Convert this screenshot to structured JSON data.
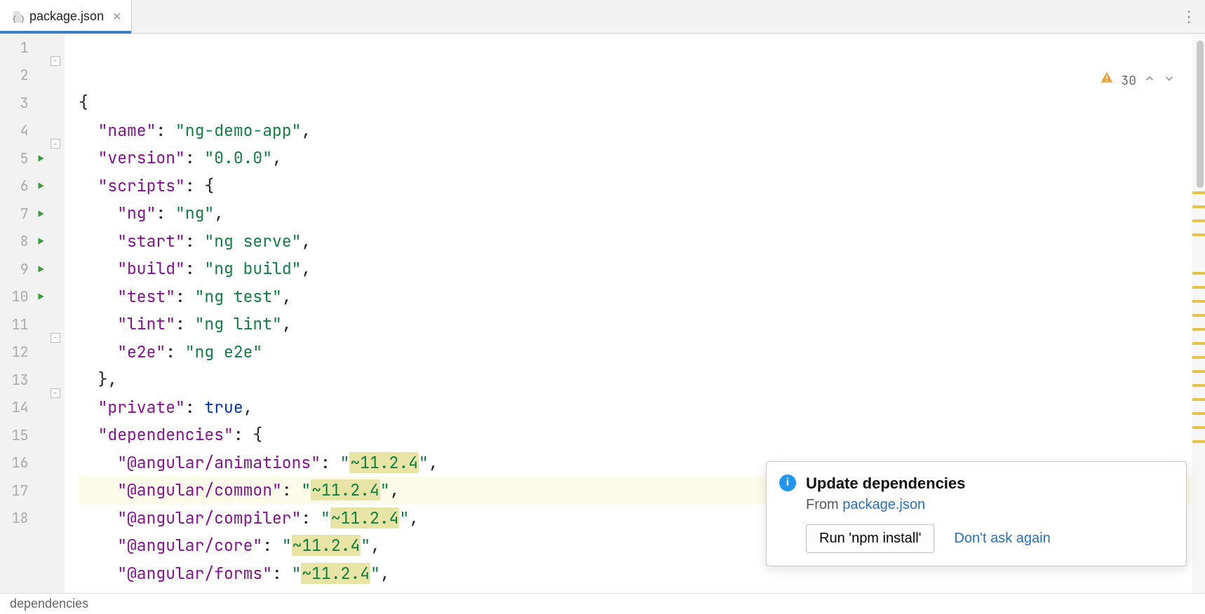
{
  "tab": {
    "filename": "package.json"
  },
  "inspections": {
    "warning_count": "30"
  },
  "breadcrumb": "dependencies",
  "popup": {
    "title": "Update dependencies",
    "from_prefix": "From ",
    "from_file": "package.json",
    "action_button": "Run 'npm install'",
    "action_link": "Don't ask again"
  },
  "code": {
    "lines": [
      {
        "n": "1",
        "run": false,
        "fold": true,
        "tokens": [
          [
            "punc",
            "{"
          ]
        ]
      },
      {
        "n": "2",
        "run": false,
        "fold": false,
        "tokens": [
          [
            "indent",
            "  "
          ],
          [
            "key",
            "\"name\""
          ],
          [
            "punc",
            ": "
          ],
          [
            "str",
            "\"ng-demo-app\""
          ],
          [
            "punc",
            ","
          ]
        ]
      },
      {
        "n": "3",
        "run": false,
        "fold": false,
        "tokens": [
          [
            "indent",
            "  "
          ],
          [
            "key",
            "\"version\""
          ],
          [
            "punc",
            ": "
          ],
          [
            "str",
            "\"0.0.0\""
          ],
          [
            "punc",
            ","
          ]
        ]
      },
      {
        "n": "4",
        "run": false,
        "fold": true,
        "tokens": [
          [
            "indent",
            "  "
          ],
          [
            "key",
            "\"scripts\""
          ],
          [
            "punc",
            ": {"
          ]
        ]
      },
      {
        "n": "5",
        "run": true,
        "fold": false,
        "tokens": [
          [
            "indent",
            "    "
          ],
          [
            "key",
            "\"ng\""
          ],
          [
            "punc",
            ": "
          ],
          [
            "str",
            "\"ng\""
          ],
          [
            "punc",
            ","
          ]
        ]
      },
      {
        "n": "6",
        "run": true,
        "fold": false,
        "tokens": [
          [
            "indent",
            "    "
          ],
          [
            "key",
            "\"start\""
          ],
          [
            "punc",
            ": "
          ],
          [
            "str",
            "\"ng serve\""
          ],
          [
            "punc",
            ","
          ]
        ]
      },
      {
        "n": "7",
        "run": true,
        "fold": false,
        "tokens": [
          [
            "indent",
            "    "
          ],
          [
            "key",
            "\"build\""
          ],
          [
            "punc",
            ": "
          ],
          [
            "str",
            "\"ng build\""
          ],
          [
            "punc",
            ","
          ]
        ]
      },
      {
        "n": "8",
        "run": true,
        "fold": false,
        "tokens": [
          [
            "indent",
            "    "
          ],
          [
            "key",
            "\"test\""
          ],
          [
            "punc",
            ": "
          ],
          [
            "str",
            "\"ng test\""
          ],
          [
            "punc",
            ","
          ]
        ]
      },
      {
        "n": "9",
        "run": true,
        "fold": false,
        "tokens": [
          [
            "indent",
            "    "
          ],
          [
            "key",
            "\"lint\""
          ],
          [
            "punc",
            ": "
          ],
          [
            "str",
            "\"ng lint\""
          ],
          [
            "punc",
            ","
          ]
        ]
      },
      {
        "n": "10",
        "run": true,
        "fold": false,
        "tokens": [
          [
            "indent",
            "    "
          ],
          [
            "key",
            "\"e2e\""
          ],
          [
            "punc",
            ": "
          ],
          [
            "str",
            "\"ng e2e\""
          ]
        ]
      },
      {
        "n": "11",
        "run": false,
        "fold": "close",
        "tokens": [
          [
            "indent",
            "  "
          ],
          [
            "punc",
            "},"
          ]
        ]
      },
      {
        "n": "12",
        "run": false,
        "fold": false,
        "tokens": [
          [
            "indent",
            "  "
          ],
          [
            "key",
            "\"private\""
          ],
          [
            "punc",
            ": "
          ],
          [
            "bool",
            "true"
          ],
          [
            "punc",
            ","
          ]
        ]
      },
      {
        "n": "13",
        "run": false,
        "fold": true,
        "tokens": [
          [
            "indent",
            "  "
          ],
          [
            "key",
            "\"dependencies\""
          ],
          [
            "punc",
            ": {"
          ]
        ]
      },
      {
        "n": "14",
        "run": false,
        "fold": false,
        "tokens": [
          [
            "indent",
            "    "
          ],
          [
            "key",
            "\"@angular/animations\""
          ],
          [
            "punc",
            ": "
          ],
          [
            "hlstr",
            "\"~11.2.4\""
          ],
          [
            "punc",
            ","
          ]
        ]
      },
      {
        "n": "15",
        "run": false,
        "fold": false,
        "current": true,
        "tokens": [
          [
            "indent",
            "    "
          ],
          [
            "key",
            "\"@angular/common\""
          ],
          [
            "punc",
            ": "
          ],
          [
            "hlstr",
            "\"~11.2.4\""
          ],
          [
            "punc",
            ","
          ]
        ]
      },
      {
        "n": "16",
        "run": false,
        "fold": false,
        "tokens": [
          [
            "indent",
            "    "
          ],
          [
            "key",
            "\"@angular/compiler\""
          ],
          [
            "punc",
            ": "
          ],
          [
            "hlstr",
            "\"~11.2.4\""
          ],
          [
            "punc",
            ","
          ]
        ]
      },
      {
        "n": "17",
        "run": false,
        "fold": false,
        "tokens": [
          [
            "indent",
            "    "
          ],
          [
            "key",
            "\"@angular/core\""
          ],
          [
            "punc",
            ": "
          ],
          [
            "hlstr",
            "\"~11.2.4\""
          ],
          [
            "punc",
            ","
          ]
        ]
      },
      {
        "n": "18",
        "run": false,
        "fold": false,
        "tokens": [
          [
            "indent",
            "    "
          ],
          [
            "key",
            "\"@angular/forms\""
          ],
          [
            "punc",
            ": "
          ],
          [
            "hlstr",
            "\"~11.2.4\""
          ],
          [
            "punc",
            ","
          ]
        ]
      }
    ]
  },
  "scroll_marks": [
    225,
    245,
    265,
    285,
    340,
    360,
    380,
    400,
    420,
    440,
    460,
    480,
    500,
    520,
    540,
    560,
    580
  ]
}
